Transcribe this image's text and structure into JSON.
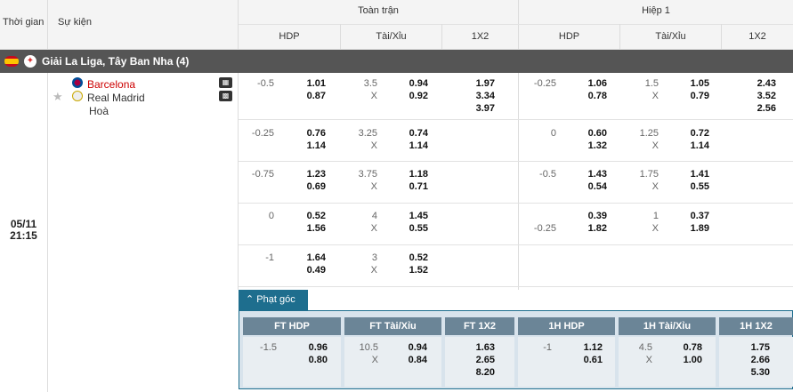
{
  "header": {
    "time_label": "Thời gian",
    "event_label": "Sự kiện",
    "full_match": "Toàn trận",
    "half1": "Hiệp 1",
    "cols": [
      "HDP",
      "Tài/Xỉu",
      "1X2",
      "HDP",
      "Tài/Xỉu",
      "1X2"
    ]
  },
  "league": {
    "name": "Giải La Liga, Tây Ban Nha (4)"
  },
  "match": {
    "date": "05/11",
    "time": "21:15",
    "home": "Barcelona",
    "away": "Real Madrid",
    "draw": "Hoà",
    "home_color": "#cc0000",
    "icons": [
      "star-icon",
      "stats-icon",
      "field-icon"
    ]
  },
  "rows": [
    {
      "ft_hdp": "-0.5",
      "ft_h1": "1.01",
      "ft_h2": "0.87",
      "ft_ou": "3.5",
      "ft_o1": "0.94",
      "ft_o2": "0.92",
      "ft_1x2": [
        "1.97",
        "3.34",
        "3.97"
      ],
      "h1_hdp": "-0.25",
      "h1_h1": "1.06",
      "h1_h2": "0.78",
      "h1_ou": "1.5",
      "h1_o1": "1.05",
      "h1_o2": "0.79",
      "h1_1x2": [
        "2.43",
        "3.52",
        "2.56"
      ]
    },
    {
      "ft_hdp": "-0.25",
      "ft_h1": "0.76",
      "ft_h2": "1.14",
      "ft_ou": "3.25",
      "ft_o1": "0.74",
      "ft_o2": "1.14",
      "h1_hdp": "0",
      "h1_h1": "0.60",
      "h1_h2": "1.32",
      "h1_ou": "1.25",
      "h1_o1": "0.72",
      "h1_o2": "1.14"
    },
    {
      "ft_hdp": "-0.75",
      "ft_h1": "1.23",
      "ft_h2": "0.69",
      "ft_ou": "3.75",
      "ft_o1": "1.18",
      "ft_o2": "0.71",
      "h1_hdp": "-0.5",
      "h1_h1": "1.43",
      "h1_h2": "0.54",
      "h1_ou": "1.75",
      "h1_o1": "1.41",
      "h1_o2": "0.55"
    },
    {
      "ft_hdp": "0",
      "ft_h1": "0.52",
      "ft_h2": "1.56",
      "ft_ou": "4",
      "ft_o1": "1.45",
      "ft_o2": "0.55",
      "h1_hdp2": "-0.25",
      "h1_h1": "0.39",
      "h1_h2": "1.82",
      "h1_ou": "1",
      "h1_o1": "0.37",
      "h1_o2": "1.89"
    },
    {
      "ft_hdp": "-1",
      "ft_h1": "1.64",
      "ft_h2": "0.49",
      "ft_ou": "3",
      "ft_o1": "0.52",
      "ft_o2": "1.52"
    }
  ],
  "x_label": "X",
  "corner": {
    "tab_label": "Phạt góc",
    "headers": [
      "FT HDP",
      "FT Tài/Xỉu",
      "FT 1X2",
      "1H HDP",
      "1H Tài/Xỉu",
      "1H 1X2"
    ],
    "ft_hdp": "-1.5",
    "ft_h1": "0.96",
    "ft_h2": "0.80",
    "ft_ou": "10.5",
    "ft_o1": "0.94",
    "ft_o2": "0.84",
    "ft_1x2": [
      "1.63",
      "2.65",
      "8.20"
    ],
    "h1_hdp": "-1",
    "h1_h1": "1.12",
    "h1_h2": "0.61",
    "h1_ou": "4.5",
    "h1_o1": "0.78",
    "h1_o2": "1.00",
    "h1_1x2": [
      "1.75",
      "2.66",
      "5.30"
    ]
  }
}
